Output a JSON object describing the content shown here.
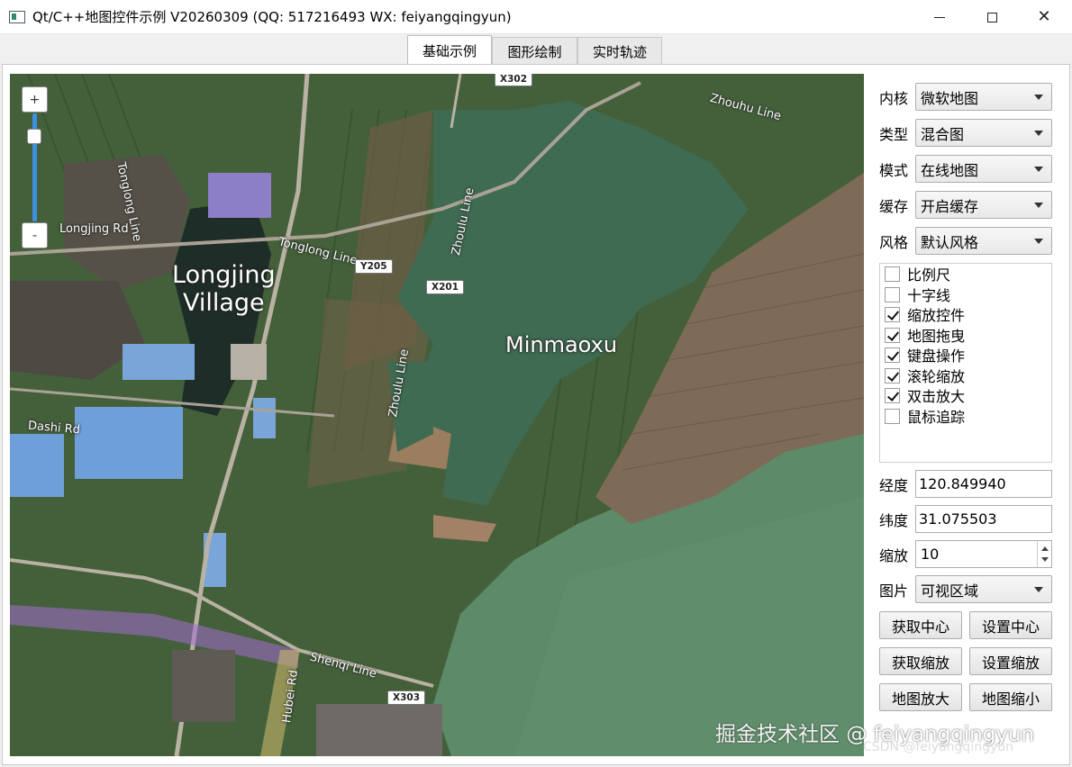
{
  "window": {
    "title": "Qt/C++地图控件示例 V20260309 (QQ: 517216493 WX: feiyangqingyun)",
    "minimize_icon": "minimize-icon",
    "maximize_icon": "maximize-icon",
    "close_icon": "close-icon",
    "close_glyph": "✕"
  },
  "tabs": [
    {
      "label": "基础示例",
      "active": true
    },
    {
      "label": "图形绘制",
      "active": false
    },
    {
      "label": "实时轨迹",
      "active": false
    }
  ],
  "map": {
    "labels": {
      "longjing_village": "Longjing\nVillage",
      "minmaoxu": "Minmaoxu",
      "tonglong_line_v": "Tonglong Line",
      "longjing_rd": "Longjing Rd",
      "tonglong_line_h": "Tonglong Line",
      "zhoulu_line_upper": "Zhoulu Line",
      "zhoulu_line_lower": "Zhoulu Line",
      "zhouhu_line": "Zhouhu Line",
      "dashi_rd": "Dashi Rd",
      "shenqi_line": "Shenqi Line",
      "hubei_rd": "Hubei Rd"
    },
    "shields": {
      "x302": "X302",
      "y205": "Y205",
      "x201": "X201",
      "x303": "X303"
    },
    "zoom_plus": "+",
    "zoom_minus": "-",
    "watermark": "掘金技术社区 @ feiyangqingyun",
    "watermark_sub": "CSDN @feiyangqingyun",
    "colors": {
      "lake": "#3f6b52",
      "farmland": "#4d6a3c",
      "village": "#7a6a58",
      "factory_roof": "#6f9fd8",
      "road": "#b9b2a3"
    }
  },
  "panel": {
    "kernel": {
      "label": "内核",
      "value": "微软地图"
    },
    "type": {
      "label": "类型",
      "value": "混合图"
    },
    "mode": {
      "label": "模式",
      "value": "在线地图"
    },
    "cache": {
      "label": "缓存",
      "value": "开启缓存"
    },
    "style": {
      "label": "风格",
      "value": "默认风格"
    },
    "options": [
      {
        "label": "比例尺",
        "checked": false
      },
      {
        "label": "十字线",
        "checked": false
      },
      {
        "label": "缩放控件",
        "checked": true
      },
      {
        "label": "地图拖曳",
        "checked": true
      },
      {
        "label": "键盘操作",
        "checked": true
      },
      {
        "label": "滚轮缩放",
        "checked": true
      },
      {
        "label": "双击放大",
        "checked": true
      },
      {
        "label": "鼠标追踪",
        "checked": false
      }
    ],
    "longitude": {
      "label": "经度",
      "value": "120.849940"
    },
    "latitude": {
      "label": "纬度",
      "value": "31.075503"
    },
    "zoom": {
      "label": "缩放",
      "value": "10"
    },
    "image": {
      "label": "图片",
      "value": "可视区域"
    },
    "buttons": {
      "get_center": "获取中心",
      "set_center": "设置中心",
      "get_zoom": "获取缩放",
      "set_zoom": "设置缩放",
      "zoom_in": "地图放大",
      "zoom_out": "地图缩小"
    }
  }
}
